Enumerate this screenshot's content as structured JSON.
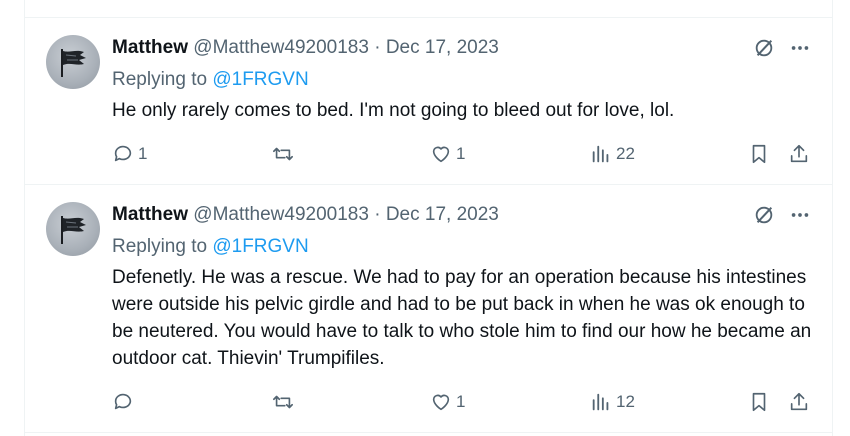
{
  "tweets": [
    {
      "author": "Matthew",
      "handle": "@Matthew49200183",
      "separator": "·",
      "date": "Dec 17, 2023",
      "replying_prefix": "Replying to",
      "replying_to": "@1FRGVN",
      "text": "He only rarely comes to bed. I'm not going to bleed out for love, lol.",
      "replies": "1",
      "retweets": "",
      "likes": "1",
      "views": "22"
    },
    {
      "author": "Matthew",
      "handle": "@Matthew49200183",
      "separator": "·",
      "date": "Dec 17, 2023",
      "replying_prefix": "Replying to",
      "replying_to": "@1FRGVN",
      "text": "Defenetly. He was a rescue. We had to pay for an operation because his intestines were outside his pelvic girdle and had to be put back in when he was ok enough to be neutered. You would have to talk to who stole him to find our how he became an outdoor cat. Thievin' Trumpifiles.",
      "replies": "",
      "retweets": "",
      "likes": "1",
      "views": "12"
    }
  ],
  "colors": {
    "text": "#0f1419",
    "secondary": "#536471",
    "link": "#1d9bf0",
    "border": "#eff3f4"
  },
  "icons": [
    "avatar-flag",
    "grok-icon",
    "more-icon",
    "reply-icon",
    "retweet-icon",
    "like-icon",
    "views-icon",
    "bookmark-icon",
    "share-icon"
  ]
}
